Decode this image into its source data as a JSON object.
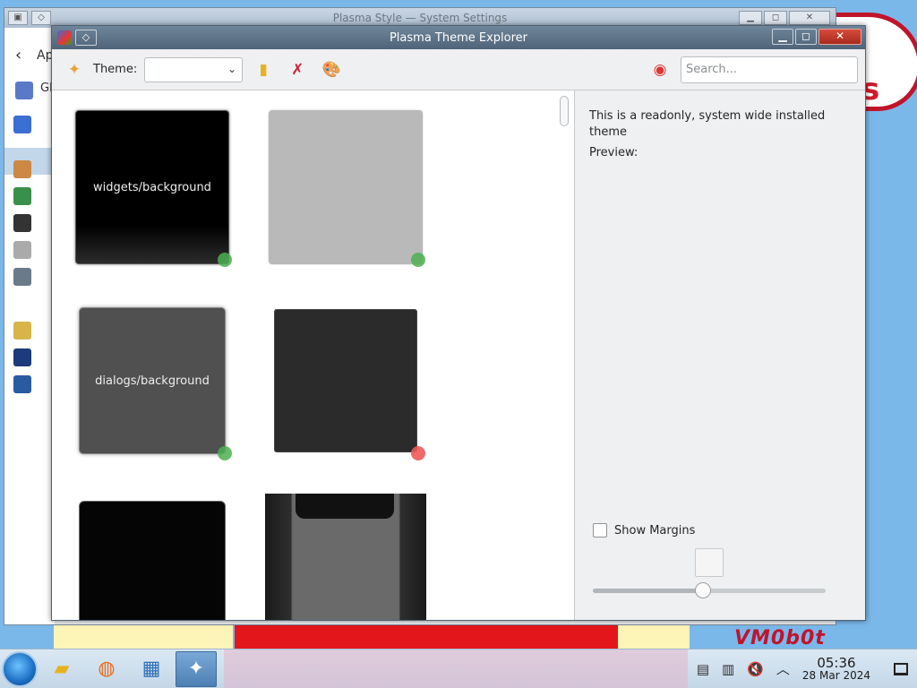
{
  "bg_window": {
    "title": "Plasma Style — System Settings",
    "back_label": "Ap",
    "sidebar_label": "Gl"
  },
  "window": {
    "title": "Plasma Theme Explorer",
    "pin_glyph": "◇",
    "minimize_glyph": "▁",
    "maximize_glyph": "◻",
    "close_glyph": "✕"
  },
  "toolbar": {
    "new_theme_icon": "new-file-icon",
    "theme_label": "Theme:",
    "theme_value": "",
    "search_placeholder": "Search..."
  },
  "tiles": [
    {
      "label": "widgets/background",
      "status": "ok"
    },
    {
      "label": "",
      "status": "ok"
    },
    {
      "label": "dialogs/background",
      "status": "ok"
    },
    {
      "label": "",
      "status": "missing"
    },
    {
      "label": "",
      "status": "none"
    },
    {
      "label": "",
      "status": "none"
    }
  ],
  "info": {
    "description": "This is a readonly, system wide installed theme",
    "preview_label": "Preview:",
    "show_margins_label": "Show Margins",
    "show_margins_checked": false,
    "slider_value": 0.47
  },
  "taskbar": {
    "time": "05:36",
    "date": "28 Mar 2024"
  },
  "colors": {
    "status_ok": "#4caf50",
    "status_missing": "#f05a5a",
    "titlebar": "#5b7087"
  }
}
